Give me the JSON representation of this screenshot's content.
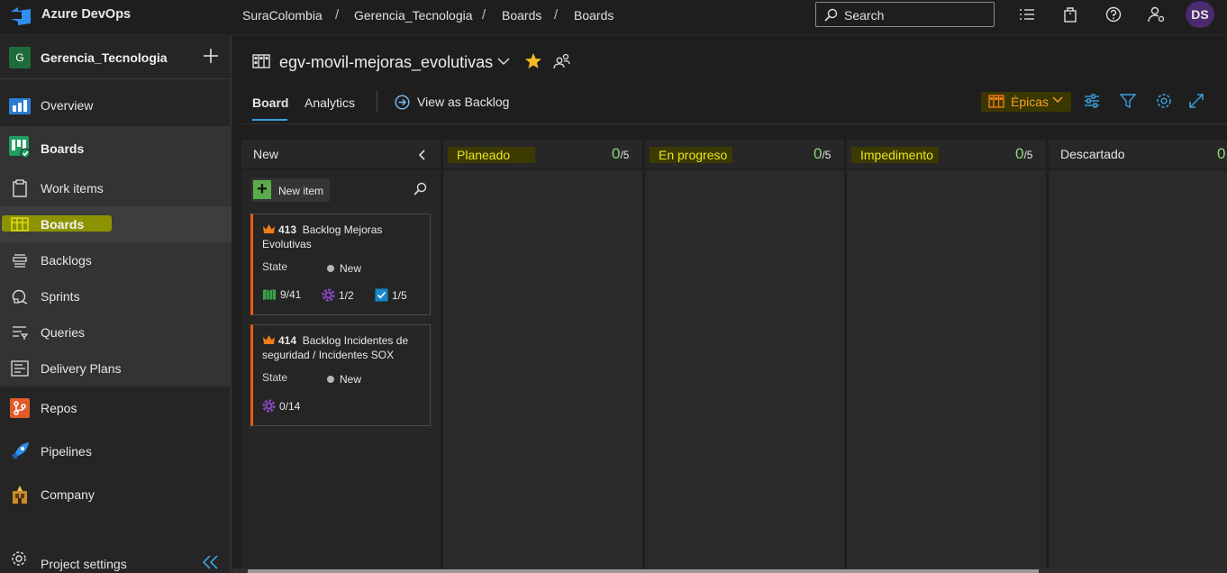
{
  "topbar": {
    "product": "Azure DevOps",
    "breadcrumbs": [
      "SuraColombia",
      "Gerencia_Tecnologia",
      "Boards",
      "Boards"
    ],
    "search_placeholder": "Search",
    "avatar_initials": "DS"
  },
  "sidebar": {
    "project_initial": "G",
    "project_name": "Gerencia_Tecnologia",
    "items": [
      {
        "label": "Overview",
        "icon": "overview-icon"
      },
      {
        "label": "Boards",
        "icon": "boards-hub-icon"
      },
      {
        "label": "Work items",
        "icon": "work-items-icon"
      },
      {
        "label": "Boards",
        "icon": "boards-icon"
      },
      {
        "label": "Backlogs",
        "icon": "backlogs-icon"
      },
      {
        "label": "Sprints",
        "icon": "sprints-icon"
      },
      {
        "label": "Queries",
        "icon": "queries-icon"
      },
      {
        "label": "Delivery Plans",
        "icon": "delivery-plans-icon"
      },
      {
        "label": "Repos",
        "icon": "repos-icon"
      },
      {
        "label": "Pipelines",
        "icon": "pipelines-icon"
      },
      {
        "label": "Company",
        "icon": "company-icon"
      }
    ],
    "settings_label": "Project settings"
  },
  "board": {
    "title": "egv-movil-mejoras_evolutivas",
    "tabs": {
      "board": "Board",
      "analytics": "Analytics"
    },
    "view_as_backlog": "View as Backlog",
    "level_selector": "Épicas",
    "columns": [
      {
        "name": "New",
        "count": "",
        "limit": ""
      },
      {
        "name": "Planeado",
        "count": "0",
        "limit": "/5"
      },
      {
        "name": "En progreso",
        "count": "0",
        "limit": "/5"
      },
      {
        "name": "Impedimento",
        "count": "0",
        "limit": "/5"
      },
      {
        "name": "Descartado",
        "count": "0",
        "limit": ""
      }
    ],
    "new_item_label": "New item",
    "cards": [
      {
        "id": "413",
        "title": "Backlog Mejoras Evolutivas",
        "state_label": "State",
        "state": "New",
        "stats": {
          "features": "9/41",
          "user_stories": "1/2",
          "tasks": "1/5"
        }
      },
      {
        "id": "414",
        "title": "Backlog Incidentes de seguridad / Incidentes SOX",
        "state_label": "State",
        "state": "New",
        "stats": {
          "user_stories": "0/14"
        }
      }
    ]
  },
  "colors": {
    "accent_blue": "#3a9fe0",
    "epic_orange": "#e8600c",
    "highlight_yellow": "#e8e620",
    "count_green": "#8cd67a"
  }
}
